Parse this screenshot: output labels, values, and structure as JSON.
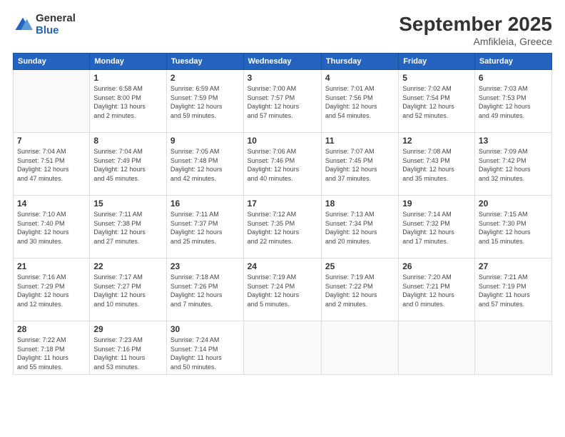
{
  "logo": {
    "general": "General",
    "blue": "Blue"
  },
  "header": {
    "month": "September 2025",
    "location": "Amfikleia, Greece"
  },
  "days_of_week": [
    "Sunday",
    "Monday",
    "Tuesday",
    "Wednesday",
    "Thursday",
    "Friday",
    "Saturday"
  ],
  "weeks": [
    [
      {
        "day": "",
        "info": ""
      },
      {
        "day": "1",
        "info": "Sunrise: 6:58 AM\nSunset: 8:00 PM\nDaylight: 13 hours\nand 2 minutes."
      },
      {
        "day": "2",
        "info": "Sunrise: 6:59 AM\nSunset: 7:59 PM\nDaylight: 12 hours\nand 59 minutes."
      },
      {
        "day": "3",
        "info": "Sunrise: 7:00 AM\nSunset: 7:57 PM\nDaylight: 12 hours\nand 57 minutes."
      },
      {
        "day": "4",
        "info": "Sunrise: 7:01 AM\nSunset: 7:56 PM\nDaylight: 12 hours\nand 54 minutes."
      },
      {
        "day": "5",
        "info": "Sunrise: 7:02 AM\nSunset: 7:54 PM\nDaylight: 12 hours\nand 52 minutes."
      },
      {
        "day": "6",
        "info": "Sunrise: 7:03 AM\nSunset: 7:53 PM\nDaylight: 12 hours\nand 49 minutes."
      }
    ],
    [
      {
        "day": "7",
        "info": "Sunrise: 7:04 AM\nSunset: 7:51 PM\nDaylight: 12 hours\nand 47 minutes."
      },
      {
        "day": "8",
        "info": "Sunrise: 7:04 AM\nSunset: 7:49 PM\nDaylight: 12 hours\nand 45 minutes."
      },
      {
        "day": "9",
        "info": "Sunrise: 7:05 AM\nSunset: 7:48 PM\nDaylight: 12 hours\nand 42 minutes."
      },
      {
        "day": "10",
        "info": "Sunrise: 7:06 AM\nSunset: 7:46 PM\nDaylight: 12 hours\nand 40 minutes."
      },
      {
        "day": "11",
        "info": "Sunrise: 7:07 AM\nSunset: 7:45 PM\nDaylight: 12 hours\nand 37 minutes."
      },
      {
        "day": "12",
        "info": "Sunrise: 7:08 AM\nSunset: 7:43 PM\nDaylight: 12 hours\nand 35 minutes."
      },
      {
        "day": "13",
        "info": "Sunrise: 7:09 AM\nSunset: 7:42 PM\nDaylight: 12 hours\nand 32 minutes."
      }
    ],
    [
      {
        "day": "14",
        "info": "Sunrise: 7:10 AM\nSunset: 7:40 PM\nDaylight: 12 hours\nand 30 minutes."
      },
      {
        "day": "15",
        "info": "Sunrise: 7:11 AM\nSunset: 7:38 PM\nDaylight: 12 hours\nand 27 minutes."
      },
      {
        "day": "16",
        "info": "Sunrise: 7:11 AM\nSunset: 7:37 PM\nDaylight: 12 hours\nand 25 minutes."
      },
      {
        "day": "17",
        "info": "Sunrise: 7:12 AM\nSunset: 7:35 PM\nDaylight: 12 hours\nand 22 minutes."
      },
      {
        "day": "18",
        "info": "Sunrise: 7:13 AM\nSunset: 7:34 PM\nDaylight: 12 hours\nand 20 minutes."
      },
      {
        "day": "19",
        "info": "Sunrise: 7:14 AM\nSunset: 7:32 PM\nDaylight: 12 hours\nand 17 minutes."
      },
      {
        "day": "20",
        "info": "Sunrise: 7:15 AM\nSunset: 7:30 PM\nDaylight: 12 hours\nand 15 minutes."
      }
    ],
    [
      {
        "day": "21",
        "info": "Sunrise: 7:16 AM\nSunset: 7:29 PM\nDaylight: 12 hours\nand 12 minutes."
      },
      {
        "day": "22",
        "info": "Sunrise: 7:17 AM\nSunset: 7:27 PM\nDaylight: 12 hours\nand 10 minutes."
      },
      {
        "day": "23",
        "info": "Sunrise: 7:18 AM\nSunset: 7:26 PM\nDaylight: 12 hours\nand 7 minutes."
      },
      {
        "day": "24",
        "info": "Sunrise: 7:19 AM\nSunset: 7:24 PM\nDaylight: 12 hours\nand 5 minutes."
      },
      {
        "day": "25",
        "info": "Sunrise: 7:19 AM\nSunset: 7:22 PM\nDaylight: 12 hours\nand 2 minutes."
      },
      {
        "day": "26",
        "info": "Sunrise: 7:20 AM\nSunset: 7:21 PM\nDaylight: 12 hours\nand 0 minutes."
      },
      {
        "day": "27",
        "info": "Sunrise: 7:21 AM\nSunset: 7:19 PM\nDaylight: 11 hours\nand 57 minutes."
      }
    ],
    [
      {
        "day": "28",
        "info": "Sunrise: 7:22 AM\nSunset: 7:18 PM\nDaylight: 11 hours\nand 55 minutes."
      },
      {
        "day": "29",
        "info": "Sunrise: 7:23 AM\nSunset: 7:16 PM\nDaylight: 11 hours\nand 53 minutes."
      },
      {
        "day": "30",
        "info": "Sunrise: 7:24 AM\nSunset: 7:14 PM\nDaylight: 11 hours\nand 50 minutes."
      },
      {
        "day": "",
        "info": ""
      },
      {
        "day": "",
        "info": ""
      },
      {
        "day": "",
        "info": ""
      },
      {
        "day": "",
        "info": ""
      }
    ]
  ]
}
